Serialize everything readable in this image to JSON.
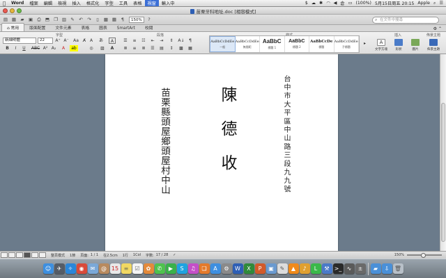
{
  "menubar": {
    "apple": "",
    "items": [
      "Word",
      "檔案",
      "編輯",
      "檢視",
      "插入",
      "格式化",
      "字型",
      "工具",
      "表格",
      "視窗",
      "輸入中"
    ],
    "active_index": 9,
    "status": {
      "script_icon": "$",
      "battery": "(100%)",
      "clock": "5月15日周五 20:15",
      "user": "Apple"
    }
  },
  "window": {
    "title": "苗栗牙科地址.doc [相容模式]"
  },
  "toolbar": {
    "zoom": "150%",
    "search_placeholder": "在文件中搜尋"
  },
  "ribbon_tabs": {
    "items": [
      "常用",
      "版面配置",
      "文件元素",
      "表格",
      "圖表",
      "SmartArt",
      "校閱"
    ],
    "active_index": 0
  },
  "ribbon": {
    "groups": {
      "font": "字型",
      "paragraph": "段落",
      "styles": "樣式",
      "insert": "插入",
      "themes": "佈景主題"
    },
    "font_name": "新細明體",
    "font_size": "22",
    "styles": [
      {
        "sample": "AaBbCcDdEe",
        "name": "一般"
      },
      {
        "sample": "AaBbCcDdEe",
        "name": "無間距"
      },
      {
        "sample": "AaBbC",
        "name": "標題 1"
      },
      {
        "sample": "AaBbC",
        "name": "標題 2"
      },
      {
        "sample": "AaBbCcDe",
        "name": "標題"
      },
      {
        "sample": "AaBbCcDdEe",
        "name": "子標題"
      }
    ],
    "insert_buttons": [
      "文字方塊",
      "形狀",
      "圖片"
    ],
    "theme_button": "佈景主題"
  },
  "document": {
    "county_address": "苗栗縣頭屋鄉頭屋村中山",
    "recipient": "陳德收",
    "sender_address": "台中市大平區中山路三段九九號"
  },
  "statusbar": {
    "mode": "整頁模式",
    "section": "1節",
    "page_label": "頁面:",
    "page": "1 / 1",
    "position": "在2.5cm",
    "line": "1行",
    "column": "1Col",
    "words_label": "字數:",
    "words": "17 / 28",
    "zoom": "150%"
  },
  "dock": {
    "icons": [
      {
        "name": "finder",
        "color": "#3d8fe0"
      },
      {
        "name": "launchpad",
        "color": "#555c66"
      },
      {
        "name": "safari",
        "color": "#2a86d9"
      },
      {
        "name": "chrome",
        "color": "#d94a3a"
      },
      {
        "name": "mail",
        "color": "#7aa8d8"
      },
      {
        "name": "contacts",
        "color": "#b88a5e"
      },
      {
        "name": "calendar",
        "color": "#e8e8e8"
      },
      {
        "name": "notes",
        "color": "#f1d862"
      },
      {
        "name": "reminders",
        "color": "#f4f4f4"
      },
      {
        "name": "photos",
        "color": "#e48a3a"
      },
      {
        "name": "messages",
        "color": "#4ec24e"
      },
      {
        "name": "facetime",
        "color": "#3ab14a"
      },
      {
        "name": "skype",
        "color": "#1fa3e0"
      },
      {
        "name": "itunes",
        "color": "#c44fc8"
      },
      {
        "name": "ibooks",
        "color": "#e47a2a"
      },
      {
        "name": "app-store",
        "color": "#3d8fe0"
      },
      {
        "name": "system-preferences",
        "color": "#8a8a8a"
      },
      {
        "name": "word",
        "color": "#2e5fb5"
      },
      {
        "name": "excel",
        "color": "#2f8a3a"
      },
      {
        "name": "powerpoint",
        "color": "#d25a2a"
      },
      {
        "name": "preview",
        "color": "#6a9ad0"
      },
      {
        "name": "textedit",
        "color": "#dcdcdc"
      },
      {
        "name": "vlc",
        "color": "#f08a1a"
      },
      {
        "name": "garageband",
        "color": "#e0a030"
      },
      {
        "name": "line",
        "color": "#3ab94a"
      },
      {
        "name": "xcode",
        "color": "#4a7ac8"
      },
      {
        "name": "terminal",
        "color": "#2a2a2a"
      },
      {
        "name": "activity-monitor",
        "color": "#5a5a5a"
      },
      {
        "name": "calculator",
        "color": "#6a6a6a"
      },
      {
        "name": "folder",
        "color": "#4a90d8"
      },
      {
        "name": "downloads",
        "color": "#4a90d8"
      },
      {
        "name": "trash",
        "color": "#b8c0c8"
      }
    ]
  }
}
